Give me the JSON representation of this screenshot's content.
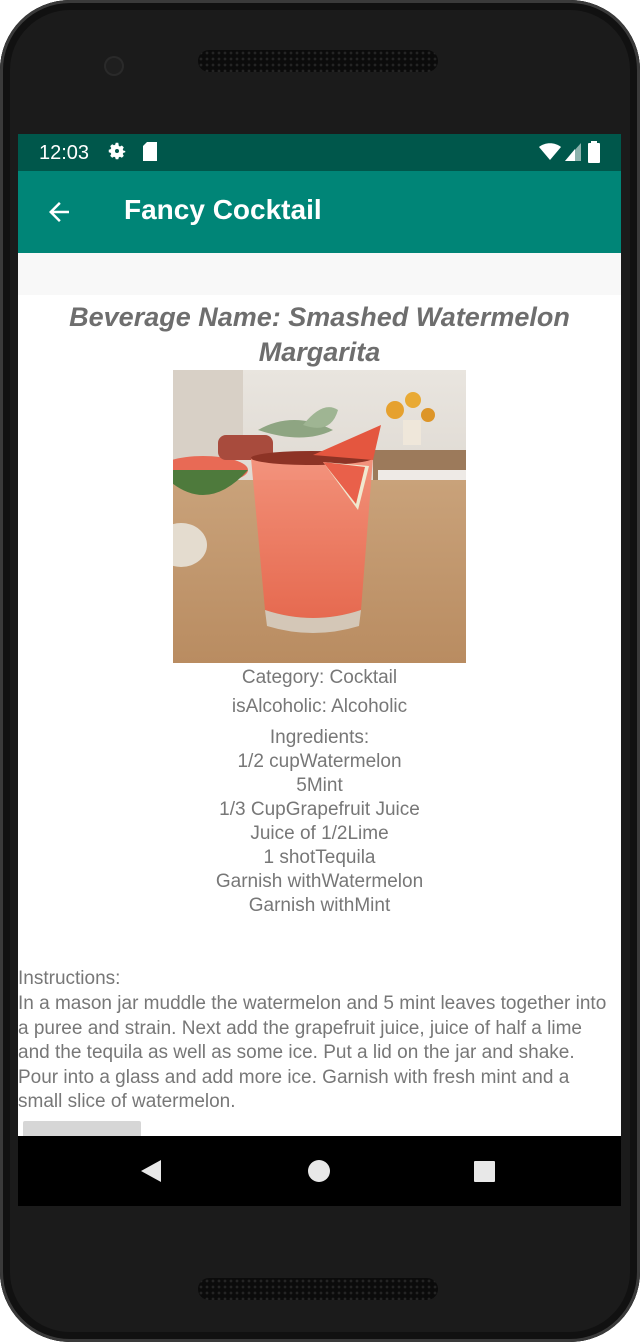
{
  "status_bar": {
    "time": "12:03"
  },
  "app_bar": {
    "title": "Fancy Cocktail"
  },
  "drink": {
    "name_heading": "Beverage Name: Smashed Watermelon Margarita",
    "category": "Category: Cocktail",
    "alcoholic": "isAlcoholic: Alcoholic",
    "ingredients_label": "Ingredients:",
    "ingredients": [
      "1/2 cupWatermelon",
      "5Mint",
      "1/3 CupGrapefruit Juice",
      "Juice of 1/2Lime",
      "1 shotTequila",
      "Garnish withWatermelon",
      "Garnish withMint"
    ],
    "instructions_label": "Instructions:",
    "instructions": "In a mason jar muddle the watermelon and 5 mint leaves together into a puree and strain. Next add the grapefruit juice, juice of half a lime and the tequila as well as some ice. Put a lid on the jar and shake. Pour into a glass and add more ice. Garnish with fresh mint and a small slice of watermelon."
  },
  "colors": {
    "status_bar": "#00574b",
    "app_bar": "#008577",
    "text": "#777777"
  },
  "icons": {
    "back": "arrow-back-icon",
    "settings": "gear-icon",
    "sd_card": "sd-card-icon",
    "wifi": "wifi-icon",
    "signal": "signal-icon",
    "battery": "battery-icon",
    "nav_back": "nav-back-icon",
    "nav_home": "nav-home-icon",
    "nav_recent": "nav-recent-icon"
  }
}
